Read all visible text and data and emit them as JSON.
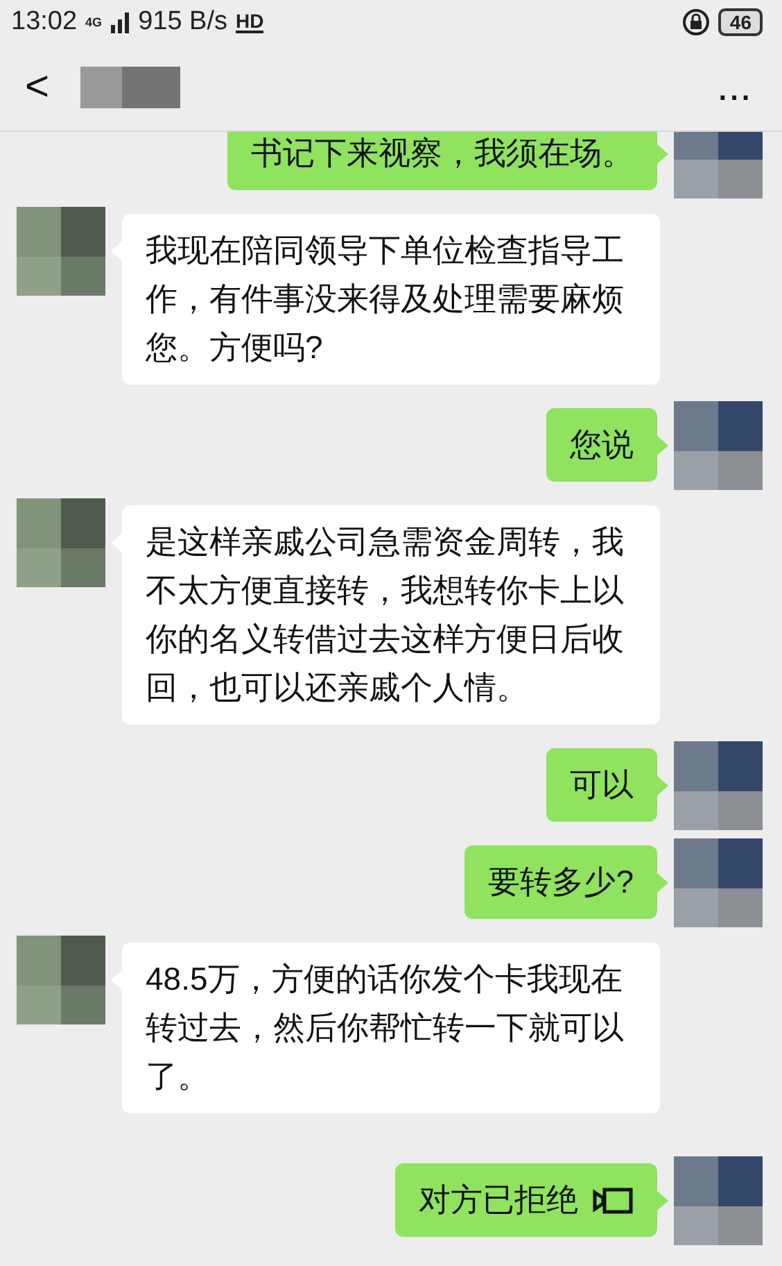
{
  "status_bar": {
    "time": "13:02",
    "network": "4G",
    "speed": "915 B/s",
    "hd": "HD",
    "battery": "46"
  },
  "nav": {
    "back": "<",
    "more": "..."
  },
  "messages": [
    {
      "sent": true,
      "kind": "text",
      "text": "书记下来视察，我须在场。"
    },
    {
      "sent": false,
      "kind": "text",
      "text": "我现在陪同领导下单位检查指导工作，有件事没来得及处理需要麻烦您。方便吗?"
    },
    {
      "sent": true,
      "kind": "text",
      "text": "您说"
    },
    {
      "sent": false,
      "kind": "text",
      "text": "是这样亲戚公司急需资金周转，我不太方便直接转，我想转你卡上以你的名义转借过去这样方便日后收回，也可以还亲戚个人情。"
    },
    {
      "sent": true,
      "kind": "text",
      "text": "可以"
    },
    {
      "sent": true,
      "kind": "text",
      "text": "要转多少?"
    },
    {
      "sent": false,
      "kind": "text",
      "text": "48.5万，方便的话你发个卡我现在转过去，然后你帮忙转一下就可以了。"
    },
    {
      "sent": true,
      "kind": "call",
      "text": "对方已拒绝"
    }
  ]
}
